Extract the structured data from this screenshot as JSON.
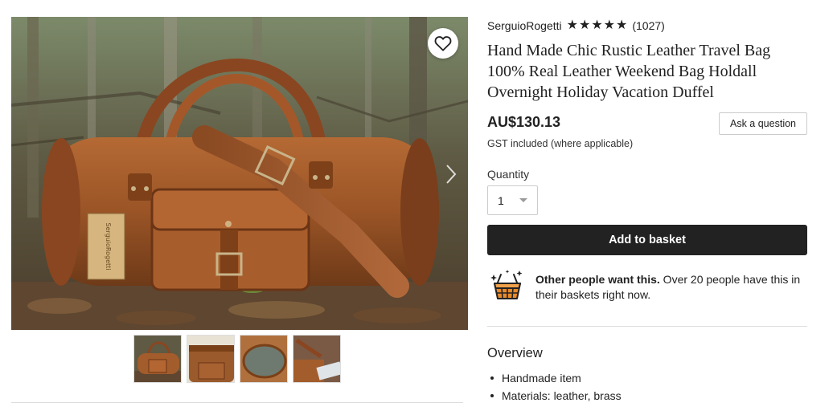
{
  "gallery": {
    "main_image_label": "SerguioRogetti",
    "thumbnails": [
      "thumbnail-1",
      "thumbnail-2",
      "thumbnail-3",
      "thumbnail-4"
    ]
  },
  "listing": {
    "shop_name": "SerguioRogetti",
    "rating": 5,
    "review_count": "(1027)",
    "title": "Hand Made Chic Rustic Leather Travel Bag 100% Real Leather Weekend Bag Holdall Overnight Holiday Vacation Duffel",
    "price": "AU$130.13",
    "tax_note": "GST included (where applicable)",
    "ask_question_label": "Ask a question"
  },
  "purchase": {
    "quantity_label": "Quantity",
    "quantity_value": "1",
    "add_to_basket_label": "Add to basket"
  },
  "demand": {
    "bold_text": "Other people want this.",
    "rest_text": " Over 20 people have this in their baskets right now."
  },
  "overview": {
    "title": "Overview",
    "items": [
      "Handmade item",
      "Materials: leather, brass"
    ]
  },
  "colors": {
    "button_dark": "#222222",
    "text": "#222222",
    "basket_icon": "#e8892b"
  },
  "icons": {
    "favorite": "heart-outline-icon",
    "next": "chevron-right-icon",
    "demand": "basket-sparkle-icon",
    "rating": "star-icon"
  }
}
